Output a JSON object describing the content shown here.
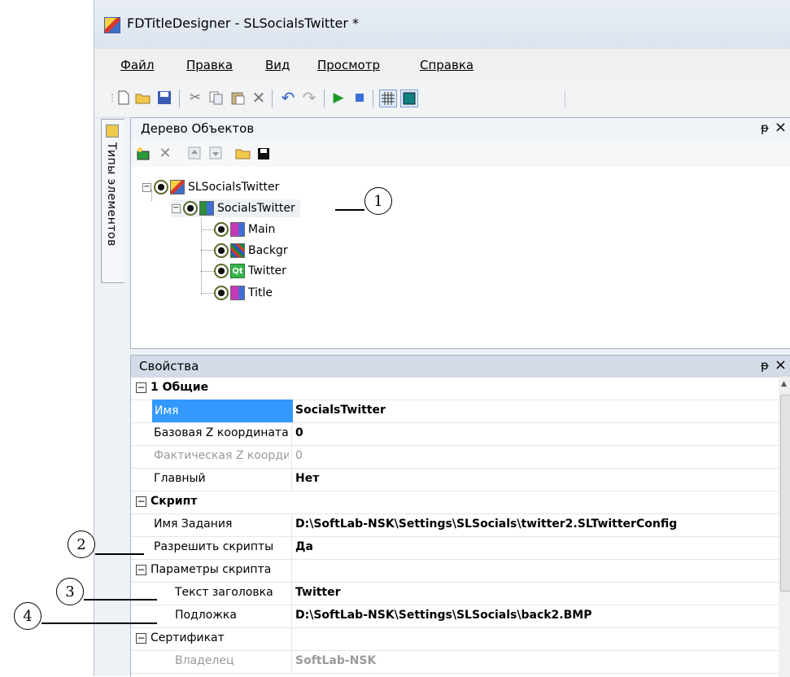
{
  "window": {
    "title": "FDTitleDesigner - SLSocialsTwitter *"
  },
  "menu": [
    {
      "label": "Файл"
    },
    {
      "label": "Правка"
    },
    {
      "label": "Вид"
    },
    {
      "label": "Просмотр"
    },
    {
      "label": "Справка"
    }
  ],
  "side_tab": {
    "label": "Типы элементов"
  },
  "tree_panel": {
    "title": "Дерево Объектов",
    "pin": "ᵽ",
    "close": "×",
    "nodes": [
      {
        "label": "SLSocialsTwitter"
      },
      {
        "label": "SocialsTwitter"
      },
      {
        "label": "Main"
      },
      {
        "label": "Backgr"
      },
      {
        "label": "Twitter"
      },
      {
        "label": "Title"
      }
    ]
  },
  "props_panel": {
    "title": "Свойства",
    "rows": [
      {
        "name": "1 Общие",
        "value": ""
      },
      {
        "name": "Имя",
        "value": "SocialsTwitter"
      },
      {
        "name": "Базовая Z координата",
        "value": "0"
      },
      {
        "name": "Фактическая Z координата",
        "value": "0"
      },
      {
        "name": "Главный",
        "value": "Нет"
      },
      {
        "name": "Скрипт",
        "value": ""
      },
      {
        "name": "Имя Задания",
        "value": "D:\\SoftLab-NSK\\Settings\\SLSocials\\twitter2.SLTwitterConfig"
      },
      {
        "name": "Разрешить скрипты",
        "value": "Да"
      },
      {
        "name": "Параметры скрипта",
        "value": ""
      },
      {
        "name": "Текст заголовка",
        "value": "Twitter"
      },
      {
        "name": "Подложка",
        "value": "D:\\SoftLab-NSK\\Settings\\SLSocials\\back2.BMP"
      },
      {
        "name": "Сертификат",
        "value": ""
      },
      {
        "name": "Владелец",
        "value": "SoftLab-NSK"
      }
    ]
  },
  "callouts": [
    "1",
    "2",
    "3",
    "4"
  ],
  "colors": {
    "selection": "#3399ff",
    "panel_border": "#a5b2c2"
  }
}
